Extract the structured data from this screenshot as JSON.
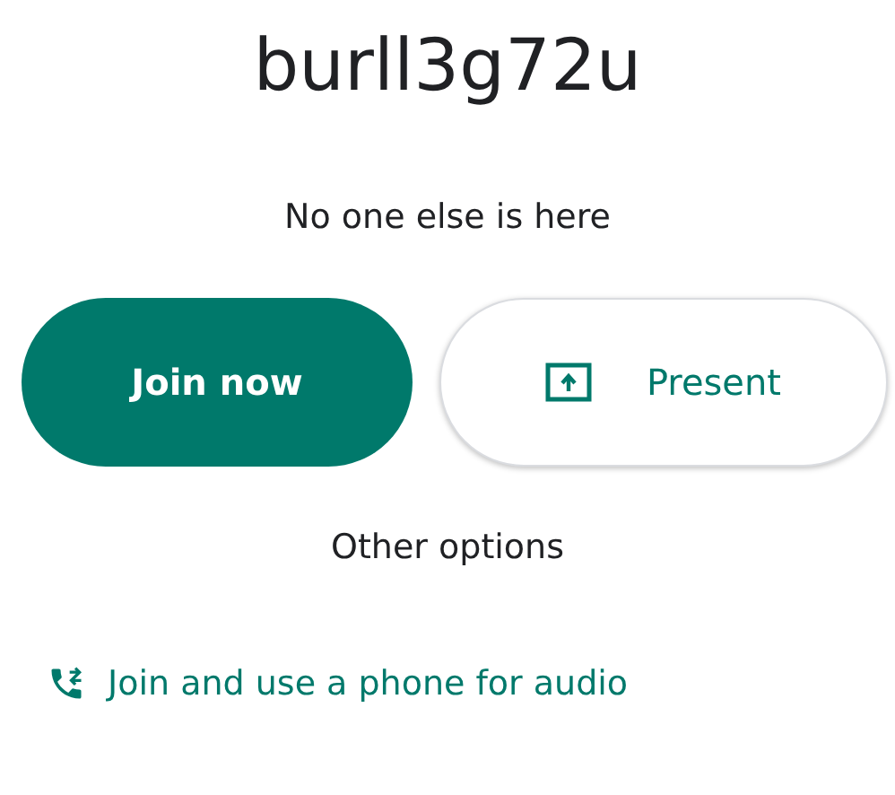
{
  "meeting_code": "burll3g72u",
  "status": "No one else is here",
  "buttons": [
    {
      "kind": "primary",
      "label": "Join now"
    },
    {
      "kind": "present",
      "label": "Present"
    }
  ],
  "other_options": {
    "heading": "Other options",
    "link": "Join and use a phone for audio"
  }
}
